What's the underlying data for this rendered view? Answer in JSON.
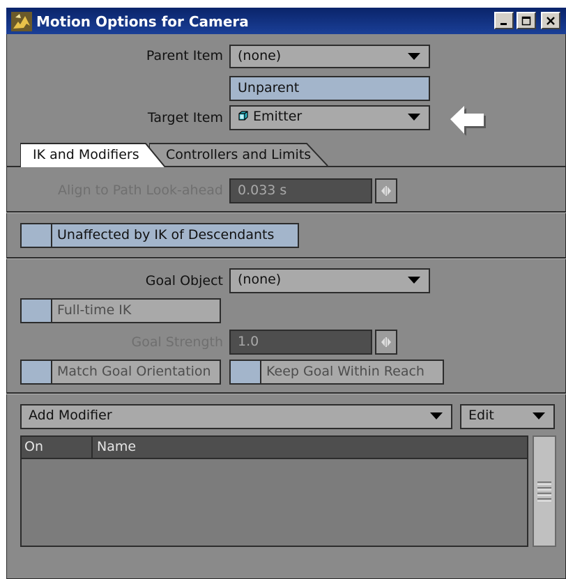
{
  "window": {
    "title": "Motion Options for Camera",
    "icon": "lightwave-icon"
  },
  "window_controls": {
    "minimize_icon": "minimize-icon",
    "maximize_icon": "maximize-icon",
    "close_icon": "close-icon"
  },
  "parent": {
    "label": "Parent Item",
    "value": "(none)"
  },
  "unparent": {
    "label": "Unparent"
  },
  "target": {
    "label": "Target Item",
    "value": "Emitter",
    "icon": "null-object-icon"
  },
  "tabs": [
    {
      "label": "IK and Modifiers",
      "active": true
    },
    {
      "label": "Controllers and Limits",
      "active": false
    }
  ],
  "align": {
    "label": "Align to Path Look-ahead",
    "value": "0.033 s"
  },
  "unaffected": {
    "label": "Unaffected by IK of Descendants"
  },
  "goal_object": {
    "label": "Goal Object",
    "value": "(none)"
  },
  "fulltime": {
    "label": "Full-time IK"
  },
  "goal_strength": {
    "label": "Goal Strength",
    "value": "1.0"
  },
  "match_goal": {
    "label": "Match Goal Orientation"
  },
  "keep_goal": {
    "label": "Keep Goal Within Reach"
  },
  "modifier": {
    "add_label": "Add Modifier",
    "edit_label": "Edit"
  },
  "list": {
    "columns": [
      "On",
      "Name"
    ],
    "rows": []
  },
  "annotation": {
    "icon": "white-arrow-left-icon"
  },
  "colors": {
    "titlebar": "#0a246a",
    "panel": "#8a8a8a",
    "blue_button": "#a3b5cb",
    "dark_field": "#4e4e4e"
  }
}
